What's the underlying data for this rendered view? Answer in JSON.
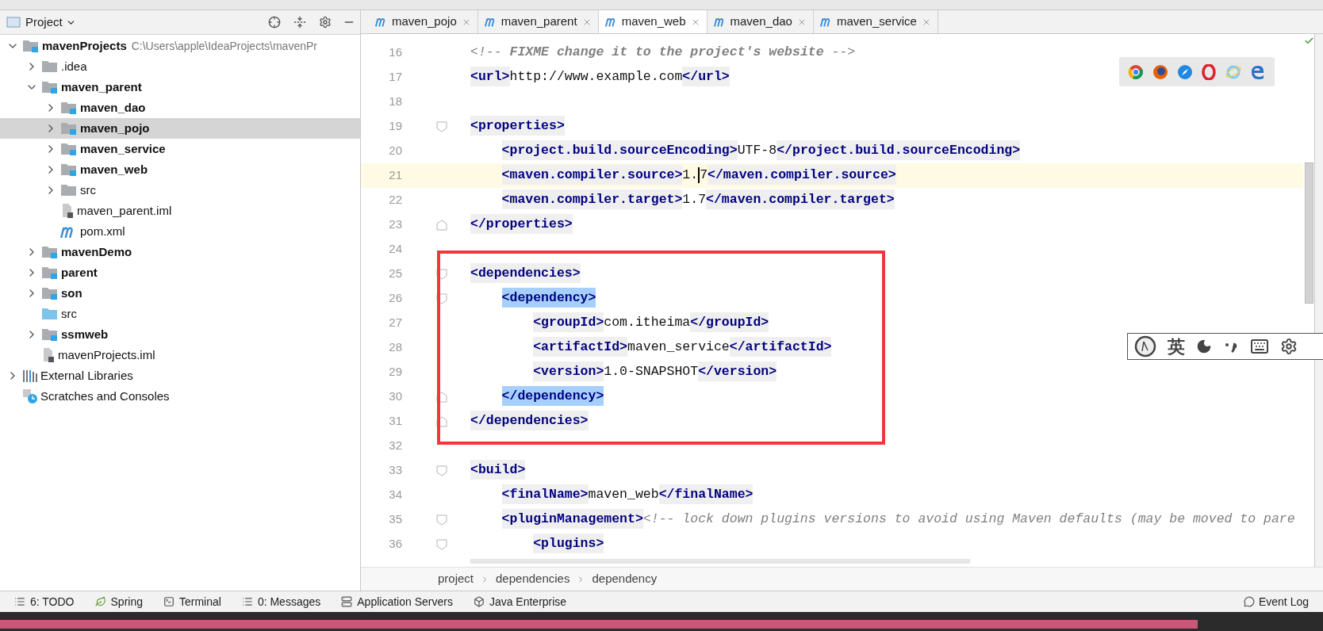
{
  "project_panel": {
    "title": "Project",
    "tree": [
      {
        "label": "mavenProjects",
        "kind": "module",
        "path": "C:\\Users\\apple\\IdeaProjects\\mavenPr",
        "expanded": true,
        "selected": false,
        "children": [
          {
            "label": ".idea",
            "kind": "folder",
            "expanded": false,
            "selected": false
          },
          {
            "label": "maven_parent",
            "kind": "module",
            "expanded": true,
            "selected": false,
            "children": [
              {
                "label": "maven_dao",
                "kind": "module",
                "expanded": false,
                "selected": false
              },
              {
                "label": "maven_pojo",
                "kind": "module",
                "expanded": false,
                "selected": true
              },
              {
                "label": "maven_service",
                "kind": "module",
                "expanded": false,
                "selected": false
              },
              {
                "label": "maven_web",
                "kind": "module",
                "expanded": false,
                "selected": false
              },
              {
                "label": "src",
                "kind": "folder",
                "expanded": false,
                "selected": false
              },
              {
                "label": "maven_parent.iml",
                "kind": "iml",
                "selected": false
              },
              {
                "label": "pom.xml",
                "kind": "pom",
                "selected": false
              }
            ]
          },
          {
            "label": "mavenDemo",
            "kind": "module",
            "expanded": false,
            "selected": false
          },
          {
            "label": "parent",
            "kind": "module",
            "expanded": false,
            "selected": false
          },
          {
            "label": "son",
            "kind": "module",
            "expanded": false,
            "selected": false
          },
          {
            "label": "src",
            "kind": "source",
            "selected": false
          },
          {
            "label": "ssmweb",
            "kind": "module",
            "expanded": false,
            "selected": false
          },
          {
            "label": "mavenProjects.iml",
            "kind": "iml",
            "selected": false
          }
        ]
      },
      {
        "label": "External Libraries",
        "kind": "libraries",
        "expanded": false,
        "selected": false
      },
      {
        "label": "Scratches and Consoles",
        "kind": "scratches",
        "selected": false
      }
    ]
  },
  "tabs": [
    {
      "label": "maven_pojo",
      "selected": false
    },
    {
      "label": "maven_parent",
      "selected": false
    },
    {
      "label": "maven_web",
      "selected": true
    },
    {
      "label": "maven_dao",
      "selected": false
    },
    {
      "label": "maven_service",
      "selected": false
    }
  ],
  "code": {
    "lines_above": [
      {
        "number": "16",
        "kind": "plain",
        "current": false,
        "segments": [
          {
            "kind": "comment",
            "text": "<!-- **FIXME change it to the project's website** -->"
          }
        ]
      },
      {
        "number": "17",
        "kind": "plain",
        "current": false,
        "segments": [
          {
            "kind": "tag",
            "text": "<url>",
            "matched": false
          },
          {
            "kind": "text",
            "text": "http://www.example.com"
          },
          {
            "kind": "tag",
            "text": "</url>",
            "matched": false
          }
        ]
      },
      {
        "number": "18",
        "kind": "plain",
        "current": false
      },
      {
        "number": "19",
        "kind": "opener",
        "current": false,
        "segments": [
          {
            "kind": "tag",
            "text": "<properties>",
            "matched": false
          }
        ],
        "children": [
          {
            "number": "20",
            "kind": "plain",
            "current": false,
            "segments": [
              {
                "kind": "tag",
                "text": "<project.build.sourceEncoding>",
                "matched": false
              },
              {
                "kind": "text",
                "text": "UTF-8"
              },
              {
                "kind": "tag",
                "text": "</project.build.sourceEncoding>",
                "matched": false
              }
            ]
          },
          {
            "number": "21",
            "kind": "plain",
            "current": true,
            "segments": [
              {
                "kind": "tag",
                "text": "<maven.compiler.source>",
                "matched": false
              },
              {
                "kind": "text",
                "text": "1."
              },
              {
                "kind": "caret"
              },
              {
                "kind": "text",
                "text": "7"
              },
              {
                "kind": "tag",
                "text": "</maven.compiler.source>",
                "matched": false
              }
            ]
          },
          {
            "number": "22",
            "kind": "plain",
            "current": false,
            "segments": [
              {
                "kind": "tag",
                "text": "<maven.compiler.target>",
                "matched": false
              },
              {
                "kind": "text",
                "text": "1.7"
              },
              {
                "kind": "tag",
                "text": "</maven.compiler.target>",
                "matched": false
              }
            ]
          }
        ]
      },
      {
        "number": "23",
        "kind": "closer",
        "current": false,
        "segments": [
          {
            "kind": "tag",
            "text": "</properties>",
            "matched": false
          }
        ]
      },
      {
        "number": "24",
        "kind": "plain",
        "current": false
      }
    ],
    "marked_block": {
      "lines": [
        {
          "number": "25",
          "kind": "opener",
          "current": false,
          "segments": [
            {
              "kind": "tag",
              "text": "<dependencies>",
              "matched": false
            }
          ],
          "children": [
            {
              "number": "26",
              "kind": "opener",
              "current": false,
              "segments": [
                {
                  "kind": "tag",
                  "text": "<dependency>",
                  "matched": true
                }
              ],
              "children": [
                {
                  "number": "27",
                  "kind": "plain",
                  "current": false,
                  "segments": [
                    {
                      "kind": "tag",
                      "text": "<groupId>",
                      "matched": false
                    },
                    {
                      "kind": "text",
                      "text": "com.itheima"
                    },
                    {
                      "kind": "tag",
                      "text": "</groupId>",
                      "matched": false
                    }
                  ]
                },
                {
                  "number": "28",
                  "kind": "plain",
                  "current": false,
                  "segments": [
                    {
                      "kind": "tag",
                      "text": "<artifactId>",
                      "matched": false
                    },
                    {
                      "kind": "text",
                      "text": "maven_service"
                    },
                    {
                      "kind": "tag",
                      "text": "</artifactId>",
                      "matched": false
                    }
                  ]
                },
                {
                  "number": "29",
                  "kind": "plain",
                  "current": false,
                  "segments": [
                    {
                      "kind": "tag",
                      "text": "<version>",
                      "matched": false
                    },
                    {
                      "kind": "text",
                      "text": "1.0-SNAPSHOT"
                    },
                    {
                      "kind": "tag",
                      "text": "</version>",
                      "matched": false
                    }
                  ]
                }
              ]
            },
            {
              "number": "30",
              "kind": "closer",
              "current": false,
              "segments": [
                {
                  "kind": "tag",
                  "text": "</dependency>",
                  "matched": true
                }
              ]
            }
          ]
        },
        {
          "number": "31",
          "kind": "closer",
          "current": false,
          "segments": [
            {
              "kind": "tag",
              "text": "</dependencies>",
              "matched": false
            }
          ]
        }
      ]
    },
    "lines_below": [
      {
        "number": "32",
        "kind": "plain",
        "current": false
      },
      {
        "number": "33",
        "kind": "opener",
        "current": false,
        "segments": [
          {
            "kind": "tag",
            "text": "<build>",
            "matched": false
          }
        ],
        "children": [
          {
            "number": "34",
            "kind": "plain",
            "current": false,
            "segments": [
              {
                "kind": "tag",
                "text": "<finalName>",
                "matched": false
              },
              {
                "kind": "text",
                "text": "maven_web"
              },
              {
                "kind": "tag",
                "text": "</finalName>",
                "matched": false
              }
            ]
          },
          {
            "number": "35",
            "kind": "opener",
            "current": false,
            "segments": [
              {
                "kind": "tag",
                "text": "<pluginManagement>",
                "matched": false
              },
              {
                "kind": "comment",
                "text": "<!-- lock down plugins versions to avoid using Maven defaults (may be moved to pare"
              }
            ],
            "children": [
              {
                "number": "36",
                "kind": "opener",
                "current": false,
                "segments": [
                  {
                    "kind": "tag",
                    "text": "<plugins>",
                    "matched": false
                  }
                ]
              }
            ]
          }
        ]
      }
    ]
  },
  "breadcrumb": [
    "project",
    "dependencies",
    "dependency"
  ],
  "ime_toolbar": {
    "mode": "英"
  },
  "tool_windows": [
    {
      "label": "6: TODO",
      "kind": "todo"
    },
    {
      "label": "Spring",
      "kind": "spring"
    },
    {
      "label": "Terminal",
      "kind": "terminal"
    },
    {
      "label": "0: Messages",
      "kind": "messages"
    },
    {
      "label": "Application Servers",
      "kind": "servers"
    },
    {
      "label": "Java Enterprise",
      "kind": "enterprise"
    }
  ],
  "event_log": {
    "label": "Event Log"
  },
  "player_bar": {
    "level": 0.905
  }
}
